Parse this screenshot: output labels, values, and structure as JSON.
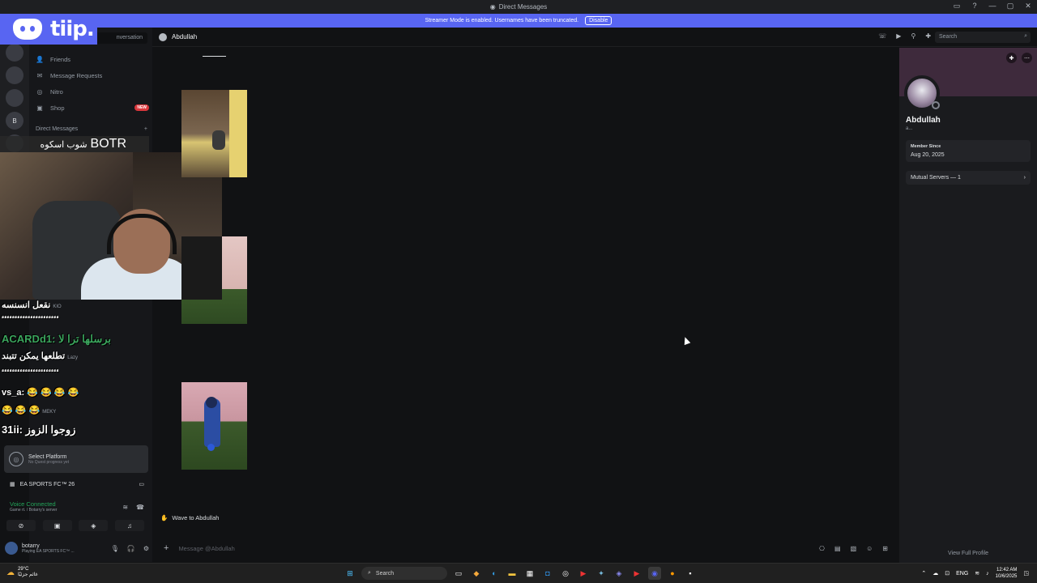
{
  "window": {
    "title": "Direct Messages",
    "controls": [
      "—",
      "▢",
      "✕"
    ]
  },
  "banner": {
    "text": "Streamer Mode is enabled. Usernames have been truncated.",
    "button": "Disable"
  },
  "overlay": {
    "logo_text": "tiip.",
    "botr_text": "BOTR",
    "botr_arabic": "شوب اسكوه"
  },
  "sidebar": {
    "search_placeholder": "nversation",
    "items": [
      {
        "label": "Friends",
        "icon": "friends-icon"
      },
      {
        "label": "Message Requests",
        "icon": "mail-icon"
      },
      {
        "label": "Nitro",
        "icon": "nitro-icon"
      },
      {
        "label": "Shop",
        "icon": "shop-icon",
        "badge": "NEW"
      }
    ],
    "dm_header": "Direct Messages",
    "dm_add": "+",
    "rail_letter": "B"
  },
  "chat_overlay": [
    {
      "text": "نقعل انسنسه",
      "extra": "KIO"
    },
    {
      "text": "ٴٴٴٴٴٴٴٴٴٴٴٴٴٴٴٴٴٴٴٴٴٴ"
    },
    {
      "text": "ACARDd1: برسلها ترا لا"
    },
    {
      "text": "تطلعها يمكن تتبند",
      "extra": "Lazy"
    },
    {
      "text": "ٴٴٴٴٴٴٴٴٴٴٴٴٴٴٴٴٴٴٴٴٴٴ"
    },
    {
      "text": "vs_a: 😂 😂 😂 😂"
    },
    {
      "text": "😂 😂 😂",
      "extra": "MEKY"
    },
    {
      "text": "31ii: زوجوا الزوز"
    }
  ],
  "user_panel": {
    "platform_title": "Select Platform",
    "platform_sub": "No Quest progress yet",
    "game": "EA SPORTS FC™ 26",
    "voice_status": "Voice Connected",
    "voice_sub": "Game rt. / Botarry's server",
    "username": "botarry",
    "user_status": "Playing EA SPORTS FC™ ..."
  },
  "header": {
    "recipient": "Abdullah",
    "search_placeholder": "Search"
  },
  "messages": {
    "wave_label": "Wave to Abdullah",
    "composer_placeholder": "Message @Abdullah"
  },
  "profile": {
    "name": "Abdullah",
    "handle": "a...",
    "member_since_label": "Member Since",
    "member_since": "Aug 20, 2025",
    "mutual_servers": "Mutual Servers — 1",
    "view_full": "View Full Profile"
  },
  "taskbar": {
    "temp": "29°C",
    "weather_sub": "غائم جزئيًا",
    "search": "Search",
    "lang": "ENG",
    "time": "12:42 AM",
    "date": "10/6/2025"
  },
  "colors": {
    "blurple": "#5865f2",
    "bg": "#111214",
    "green": "#23a55a"
  }
}
